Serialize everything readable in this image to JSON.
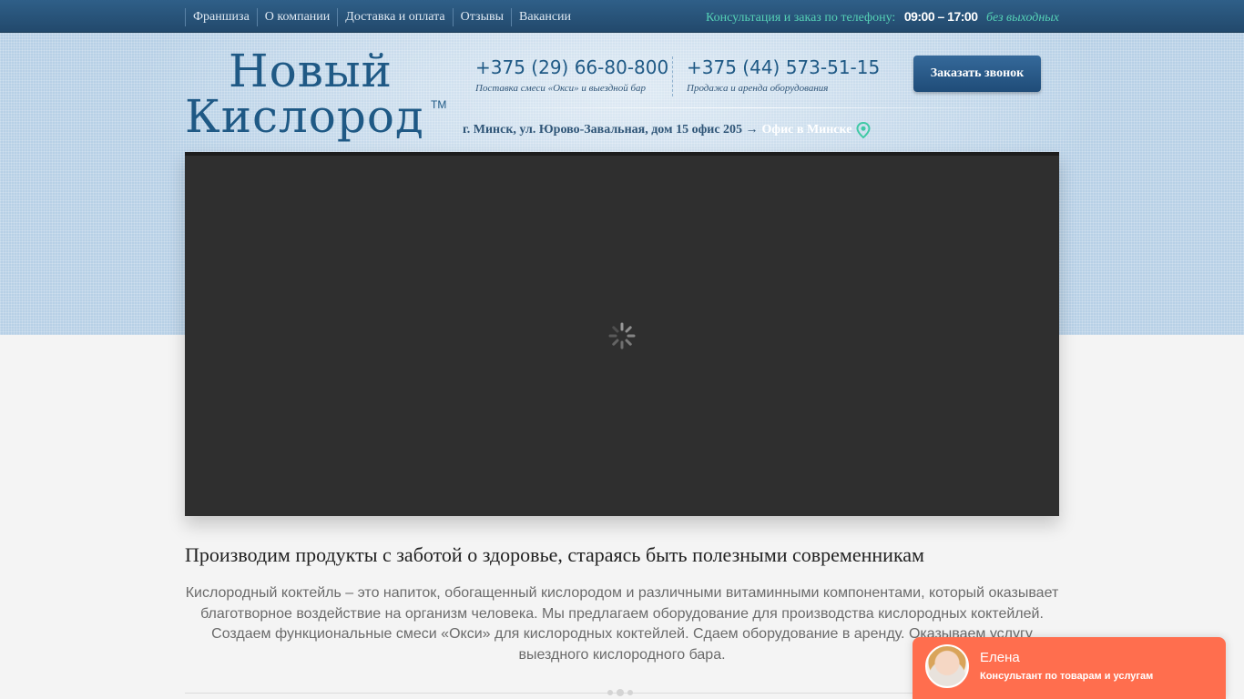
{
  "topbar": {
    "nav": [
      "Франшиза",
      "О компании",
      "Доставка и оплата",
      "Отзывы",
      "Вакансии"
    ],
    "consult_label": "Консультация и заказ по телефону:",
    "hours": "09:00 – 17:00",
    "days": "без выходных"
  },
  "logo": {
    "line1": "Новый",
    "line2": "Кислород",
    "tm": "TM"
  },
  "phones": [
    {
      "number": "+375 (29) 66-80-800",
      "desc": "Поставка смеси «Окси» и выездной бар"
    },
    {
      "number": "+375 (44) 573-51-15",
      "desc": "Продажа и аренда оборудования"
    }
  ],
  "call_button": "Заказать звонок",
  "address": {
    "text": "г. Минск, ул. Юрово-Завальная, дом 15 офис 205 →",
    "office_link": "Офис в Минске"
  },
  "content": {
    "headline": "Производим продукты с заботой о здоровье, стараясь быть полезными современникам",
    "paragraph": "Кислородный коктейль – это напиток, обогащенный кислородом и различными витаминными компонентами, который оказывает благотворное воздействие на организм человека. Мы предлагаем оборудование для производства кислородных коктейлей. Создаем функциональные смеси «Окси» для кислородных коктейлей. Сдаем оборудование в аренду. Оказываем услугу выездного кислородного бара."
  },
  "chat": {
    "name": "Елена",
    "role": "Консультант по товарам и услугам"
  },
  "colors": {
    "accent": "#1f5985",
    "teal": "#55d0b5",
    "chat": "#ff6e4e"
  }
}
